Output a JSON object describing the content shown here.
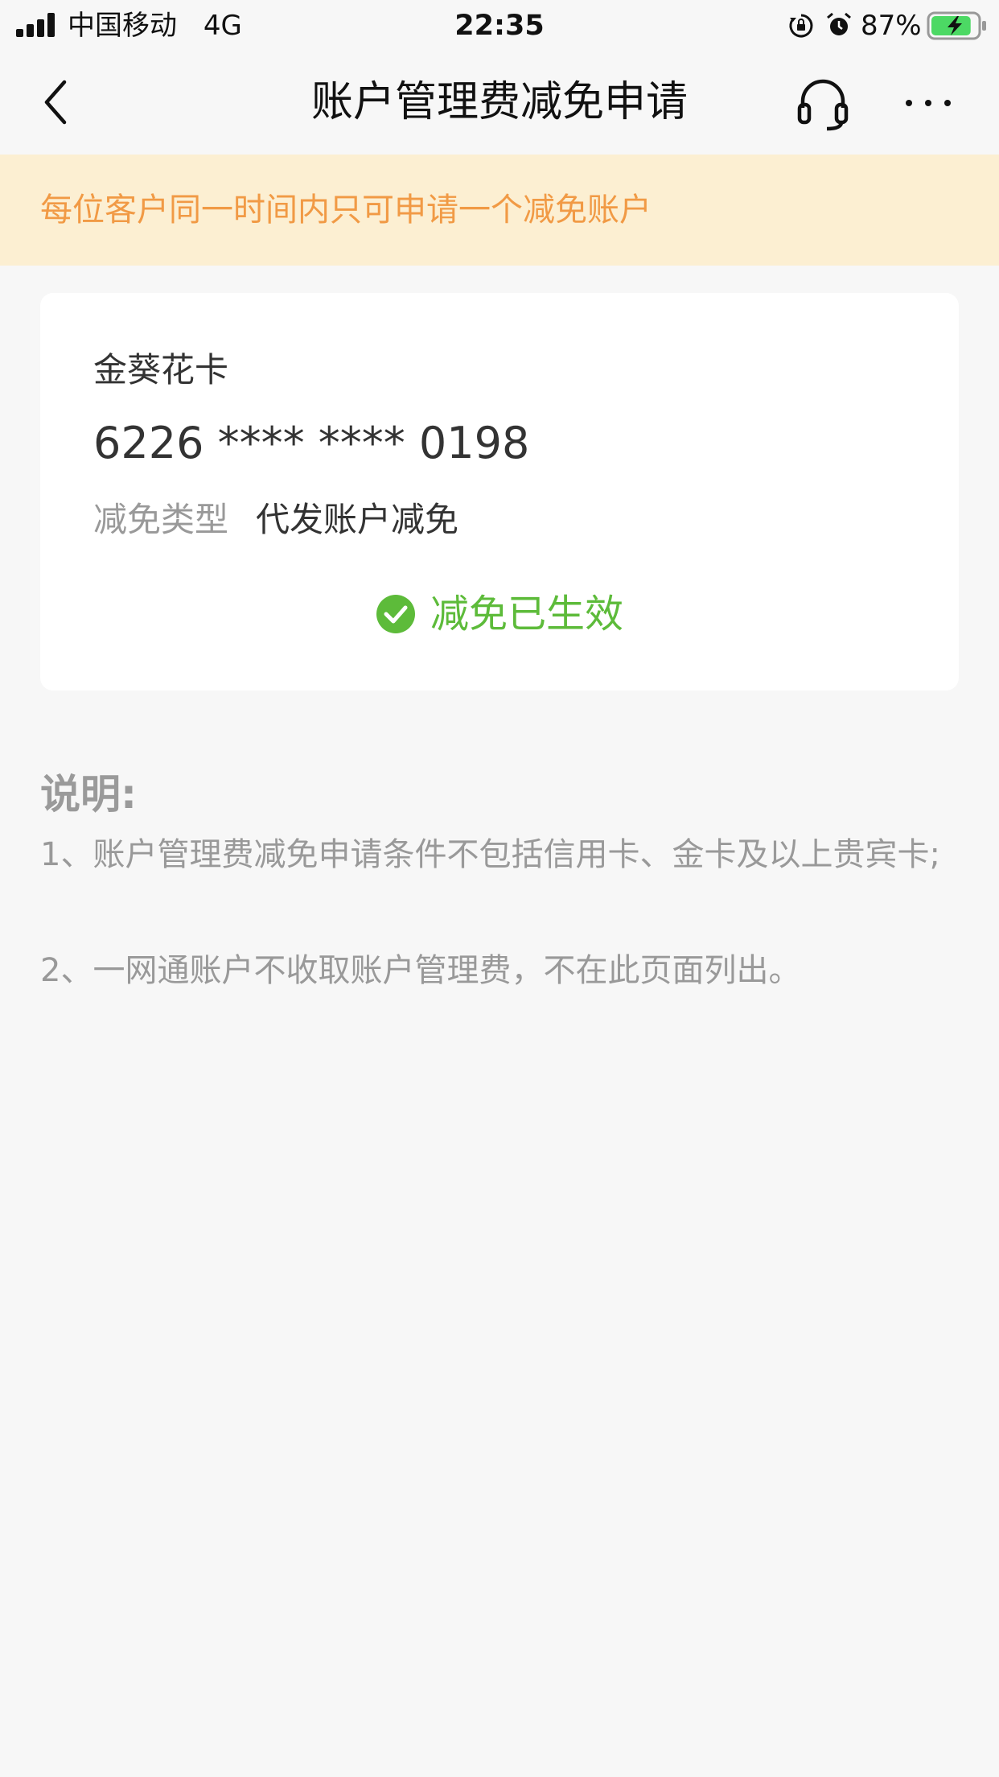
{
  "status_bar": {
    "carrier": "中国移动",
    "network": "4G",
    "time": "22:35",
    "battery_percent": "87%",
    "battery_level": 0.87,
    "battery_color": "#4cd964"
  },
  "nav": {
    "title": "账户管理费减免申请",
    "back_icon": "chevron-left-icon",
    "service_icon": "headset-icon",
    "more_icon": "more-dots-icon"
  },
  "notice": {
    "text": "每位客户同一时间内只可申请一个减免账户",
    "bg_color": "#fcefd2",
    "text_color": "#f19a45"
  },
  "card": {
    "name": "金葵花卡",
    "number": "6226 **** **** 0198",
    "waiver_type_label": "减免类型",
    "waiver_type_value": "代发账户减免",
    "status": "减免已生效",
    "status_icon": "check-circle-icon",
    "status_color": "#5dbb3a"
  },
  "notes": {
    "title": "说明:",
    "items": [
      "1、账户管理费减免申请条件不包括信用卡、金卡及以上贵宾卡;",
      "2、一网通账户不收取账户管理费，不在此页面列出。"
    ]
  }
}
